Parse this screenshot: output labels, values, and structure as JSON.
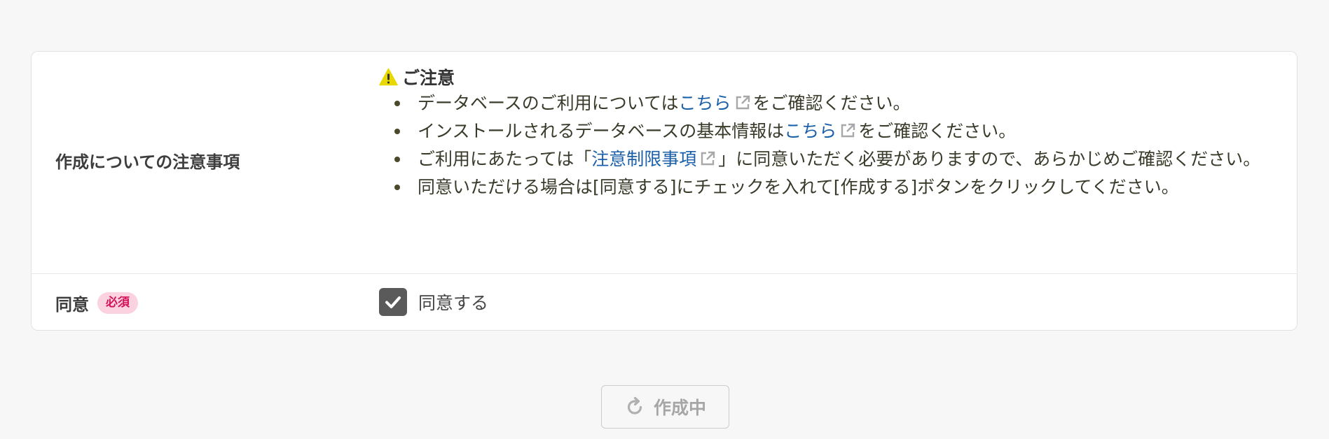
{
  "notes_row": {
    "label": "作成についての注意事項",
    "caution_title": "ご注意",
    "items": [
      {
        "before": "データベースのご利用については",
        "link": "こちら",
        "after": "をご確認ください。"
      },
      {
        "before": "インストールされるデータベースの基本情報は",
        "link": "こちら",
        "after": "をご確認ください。"
      },
      {
        "before": "ご利用にあたっては「",
        "link": "注意制限事項",
        "after": "」に同意いただく必要がありますので、あらかじめご確認ください。"
      },
      {
        "text": "同意いただける場合は[同意する]にチェックを入れて[作成する]ボタンをクリックしてください。"
      }
    ]
  },
  "consent_row": {
    "label": "同意",
    "required_badge": "必須",
    "checkbox_label": "同意する",
    "checked": true
  },
  "submit": {
    "label": "作成中",
    "icon": "refresh-icon"
  },
  "colors": {
    "link": "#1a5fa8",
    "warning": "#e6d800",
    "badge_bg": "#fbd3e0",
    "badge_text": "#d4145a",
    "checkbox": "#5a5a5a",
    "disabled_text": "#a6a6a6"
  }
}
